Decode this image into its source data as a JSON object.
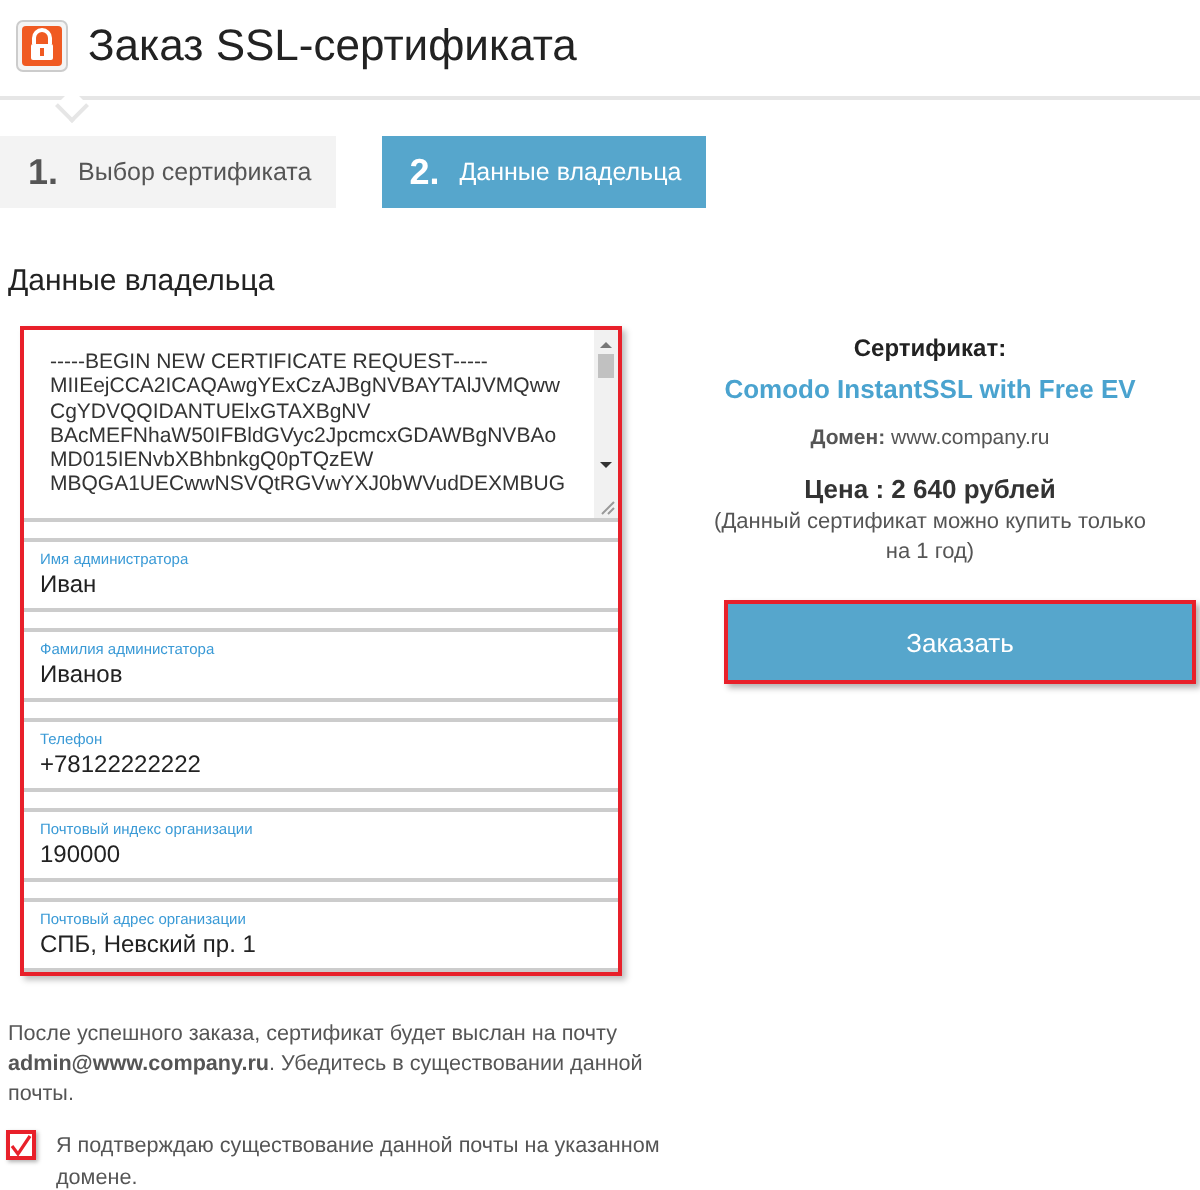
{
  "page": {
    "title": "Заказ SSL-сертификата"
  },
  "steps": [
    {
      "number": "1.",
      "label": "Выбор сертификата",
      "selected": false
    },
    {
      "number": "2.",
      "label": "Данные владельца",
      "selected": true
    }
  ],
  "section_title": "Данные владельца",
  "csr": {
    "lines": [
      "-----BEGIN NEW CERTIFICATE REQUEST-----",
      "MIIEejCCA2ICAQAwgYExCzAJBgNVBAYTAlJVMQww",
      "CgYDVQQIDANTUElxGTAXBgNV",
      "BAcMEFNhaW50IFBldGVyc2JpcmcxGDAWBgNVBAo",
      "MD015IENvbXBhbnkgQ0pTQzEW",
      "MBQGA1UECwwNSVQtRGVwYXJ0bWVudDEXMBUG"
    ]
  },
  "fields": [
    {
      "label": "Имя администратора",
      "value": "Иван"
    },
    {
      "label": "Фамилия администатора",
      "value": "Иванов"
    },
    {
      "label": "Телефон",
      "value": "+78122222222"
    },
    {
      "label": "Почтовый индекс организации",
      "value": "190000"
    },
    {
      "label": "Почтовый адрес организации",
      "value": "СПБ, Невский пр. 1"
    }
  ],
  "notice": "После успешного заказа, сертификат будет выслан на почту **admin@www.company.ru**. Убедитесь в существовании данной почты.",
  "confirm": {
    "label": "Я подтверждаю существование данной почты на указанном домене.",
    "checked": true
  },
  "summary": {
    "certificate_label": "Сертификат:",
    "certificate_name": "Comodo InstantSSL with Free EV",
    "domain_label": "Домен:",
    "domain": "www.company.ru",
    "price": "Цена : 2 640 рублей",
    "price_note": "(Данный сертификат можно купить только на 1 год)",
    "order_button": "Заказать"
  }
}
